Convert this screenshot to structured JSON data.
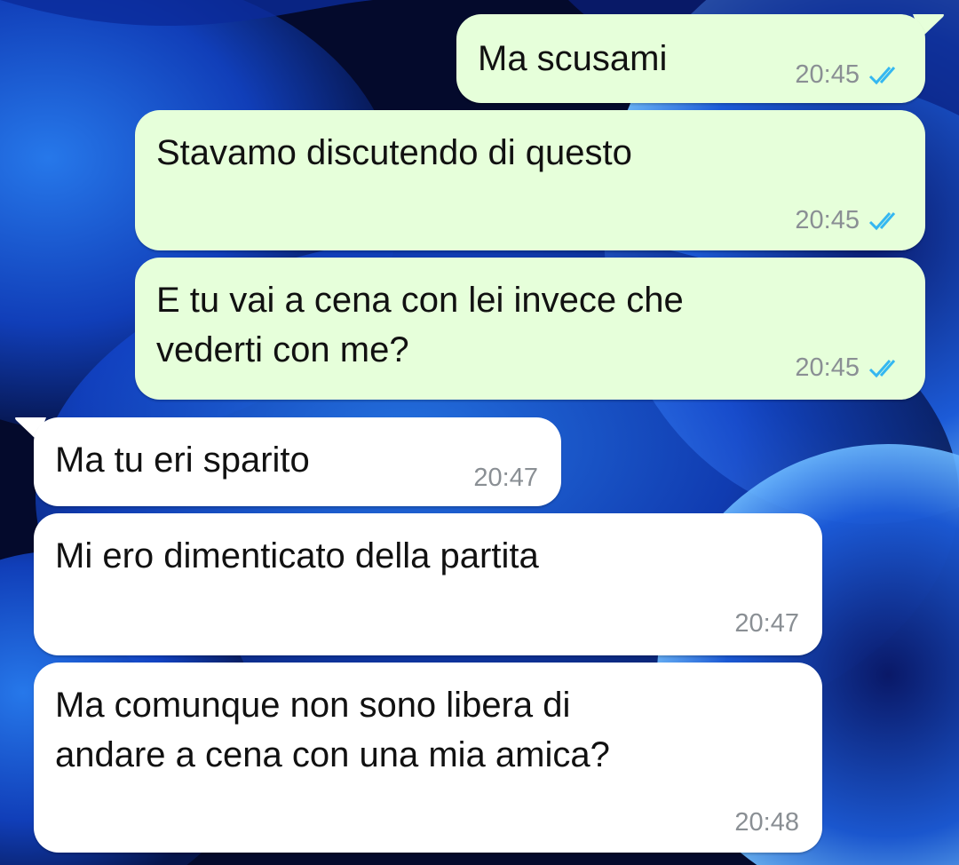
{
  "colors": {
    "outgoing_bubble": "#e6ffda",
    "incoming_bubble": "#ffffff",
    "read_ticks": "#34b7f1",
    "timestamp": "#8a8f94",
    "wallpaper": "#1f6ae0"
  },
  "status_icon": "double-check-read-icon",
  "messages": [
    {
      "direction": "outgoing",
      "text": "Ma scusami",
      "time": "20:45",
      "status": "read"
    },
    {
      "direction": "outgoing",
      "text": "Stavamo discutendo di questo",
      "time": "20:45",
      "status": "read"
    },
    {
      "direction": "outgoing",
      "text": "E tu vai a cena con lei invece che\nvederti con me?",
      "time": "20:45",
      "status": "read"
    },
    {
      "direction": "incoming",
      "text": "Ma tu eri sparito",
      "time": "20:47"
    },
    {
      "direction": "incoming",
      "text": "Mi ero dimenticato della partita",
      "time": "20:47"
    },
    {
      "direction": "incoming",
      "text": "Ma comunque non sono libera di\nandare a cena con una mia amica?",
      "time": "20:48"
    }
  ]
}
